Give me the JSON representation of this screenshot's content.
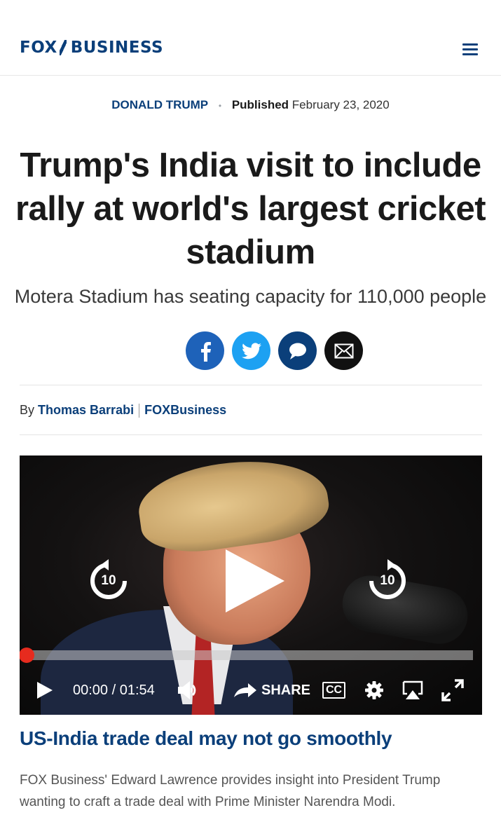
{
  "header": {
    "logo": {
      "fox": "FOX",
      "business": "BUSINESS"
    },
    "menu_icon": "hamburger-menu-icon"
  },
  "article": {
    "category": "DONALD TRUMP",
    "published_label": "Published",
    "published_date": "February 23, 2020",
    "headline": "Trump's India visit to include rally at world's largest cricket stadium",
    "subheadline": "Motera Stadium has seating capacity for 110,000 people",
    "share_buttons": [
      {
        "icon": "facebook-icon",
        "color": "#1e62b9"
      },
      {
        "icon": "twitter-icon",
        "color": "#1da1f2"
      },
      {
        "icon": "comment-icon",
        "color": "#0b3f7a"
      },
      {
        "icon": "email-icon",
        "color": "#111111"
      }
    ],
    "byline": {
      "by": "By",
      "author": "Thomas Barrabi",
      "outlet": "FOXBusiness"
    }
  },
  "video": {
    "rewind_label": "10",
    "forward_label": "10",
    "current_time": "00:00",
    "time_separator": "/",
    "duration": "01:54",
    "progress": 0.0,
    "share_label": "SHARE",
    "cc_label": "CC",
    "caption_title": "US-India trade deal may not go smoothly",
    "caption_description": "FOX Business' Edward Lawrence provides insight into President Trump wanting to craft a trade deal with Prime Minister Narendra Modi."
  },
  "colors": {
    "brand_navy": "#0b3f7a",
    "progress_red": "#e62b1e"
  }
}
